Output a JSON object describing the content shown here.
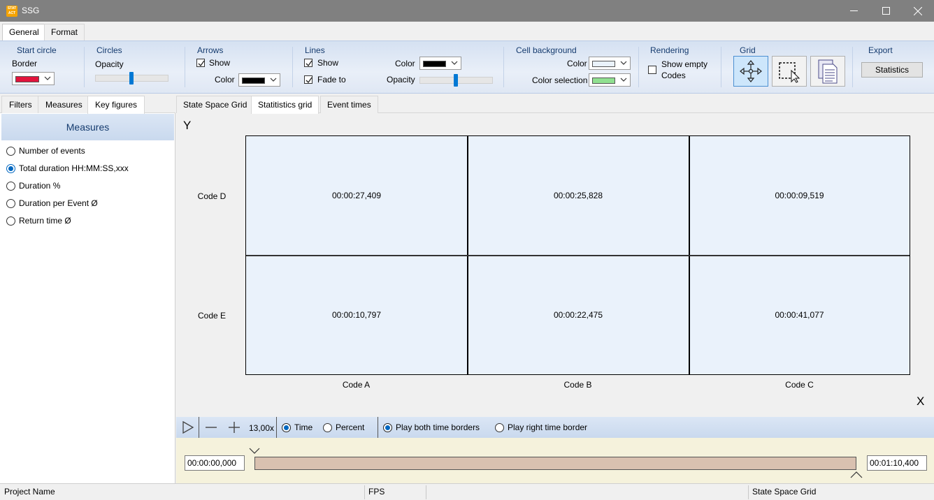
{
  "window": {
    "title": "SSG",
    "app_icon_text": "STAT ACT"
  },
  "ribbon_tabs": [
    "General",
    "Format"
  ],
  "ribbon": {
    "start_circle": {
      "title": "Start circle",
      "border_label": "Border",
      "border_color": "#e2143c"
    },
    "circles": {
      "title": "Circles",
      "opacity_label": "Opacity",
      "opacity_value": 0.5
    },
    "arrows": {
      "title": "Arrows",
      "show_label": "Show",
      "color_label": "Color",
      "color": "#000000"
    },
    "lines": {
      "title": "Lines",
      "show_label": "Show",
      "fade_label": "Fade to",
      "color_label": "Color",
      "color": "#000000",
      "opacity_label": "Opacity",
      "opacity_value": 0.5
    },
    "cell_background": {
      "title": "Cell background",
      "color_label": "Color",
      "color": "#eaf2fb",
      "selection_label": "Color selection",
      "selection_color": "#90e090"
    },
    "rendering": {
      "title": "Rendering",
      "show_empty_label_1": "Show empty",
      "show_empty_label_2": "Codes"
    },
    "grid": {
      "title": "Grid",
      "buttons": [
        "move-icon",
        "select-region-icon",
        "copy-document-icon"
      ]
    },
    "export": {
      "title": "Export",
      "statistics_label": "Statistics"
    }
  },
  "left_panel": {
    "tabs": [
      "Filters",
      "Measures",
      "Key figures"
    ],
    "header": "Measures",
    "options": [
      {
        "label": "Number of events",
        "selected": false
      },
      {
        "label": "Total duration HH:MM:SS,xxx",
        "selected": true
      },
      {
        "label": "Duration %",
        "selected": false
      },
      {
        "label": "Duration per Event Ø",
        "selected": false
      },
      {
        "label": "Return time Ø",
        "selected": false
      }
    ]
  },
  "main": {
    "tabs": [
      "State Space Grid",
      "Statitistics grid",
      "Event times"
    ],
    "axis_y": "Y",
    "axis_x": "X",
    "rows": [
      "Code D",
      "Code E"
    ],
    "columns": [
      "Code A",
      "Code B",
      "Code C"
    ],
    "cells": [
      [
        "00:00:27,409",
        "00:00:25,828",
        "00:00:09,519"
      ],
      [
        "00:00:10,797",
        "00:00:22,475",
        "00:00:41,077"
      ]
    ]
  },
  "player": {
    "zoom": "13,00x",
    "time_label": "Time",
    "percent_label": "Percent",
    "play_both_label": "Play both time borders",
    "play_right_label": "Play right time border",
    "mode_time_selected": true,
    "play_both_selected": true
  },
  "timeline": {
    "start": "00:00:00,000",
    "end": "00:01:10,400"
  },
  "status": {
    "project": "Project Name",
    "fps": "FPS",
    "view": "State Space Grid"
  }
}
